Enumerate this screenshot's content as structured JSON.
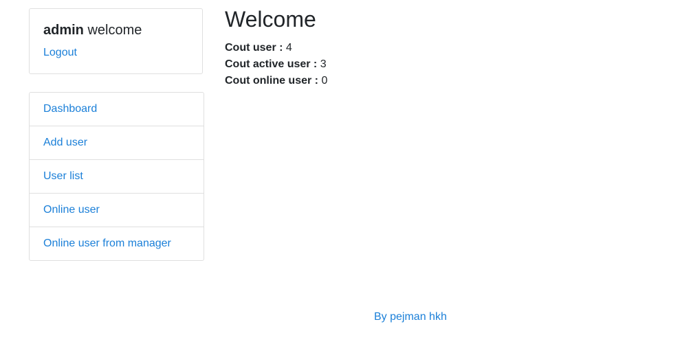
{
  "user_card": {
    "username": "admin",
    "greeting_suffix": "welcome",
    "logout_label": "Logout"
  },
  "sidebar": {
    "items": [
      {
        "label": "Dashboard"
      },
      {
        "label": "Add user"
      },
      {
        "label": "User list"
      },
      {
        "label": "Online user"
      },
      {
        "label": "Online user from manager"
      }
    ]
  },
  "main": {
    "title": "Welcome",
    "stats": [
      {
        "label": "Cout user :",
        "value": "4"
      },
      {
        "label": "Cout active user :",
        "value": "3"
      },
      {
        "label": "Cout online user :",
        "value": "0"
      }
    ]
  },
  "footer": {
    "credit": "By pejman hkh"
  },
  "colors": {
    "link": "#1a7fd8",
    "border": "#dfdfdf",
    "text": "#212529"
  }
}
